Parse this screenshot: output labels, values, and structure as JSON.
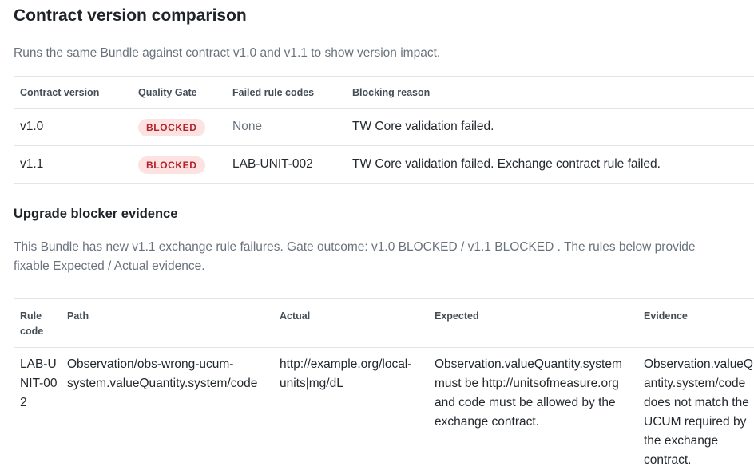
{
  "title": "Contract version comparison",
  "subtitle": "Runs the same Bundle against contract v1.0 and v1.1 to show version impact.",
  "comparison": {
    "headers": [
      "Contract version",
      "Quality Gate",
      "Failed rule codes",
      "Blocking reason"
    ],
    "rows": [
      {
        "version": "v1.0",
        "gate": "BLOCKED",
        "failed_codes": "None",
        "reason": "TW Core validation failed."
      },
      {
        "version": "v1.1",
        "gate": "BLOCKED",
        "failed_codes": "LAB-UNIT-002",
        "reason": "TW Core validation failed. Exchange contract rule failed."
      }
    ],
    "badge_color": "#b4232a",
    "badge_bg": "#fde2e2"
  },
  "evidence_section": {
    "heading": "Upgrade blocker evidence",
    "description": "This Bundle has new v1.1 exchange rule failures. Gate outcome: v1.0 BLOCKED / v1.1 BLOCKED . The rules below provide fixable Expected / Actual evidence.",
    "headers": {
      "rule_code": "Rule code",
      "path": "Path",
      "actual": "Actual",
      "expected": "Expected",
      "evidence": "Evidence"
    },
    "rows": [
      {
        "rule_code": "LAB-UNIT-002",
        "path": "Observation/obs-wrong-ucum-system.valueQuantity.system/code",
        "actual": "http://example.org/local-units|mg/dL",
        "expected": "Observation.valueQuantity.system must be http://unitsofmeasure.org and code must be allowed by the exchange contract.",
        "evidence": "Observation.valueQuantity.system/code does not match the UCUM required by the exchange contract."
      }
    ]
  }
}
